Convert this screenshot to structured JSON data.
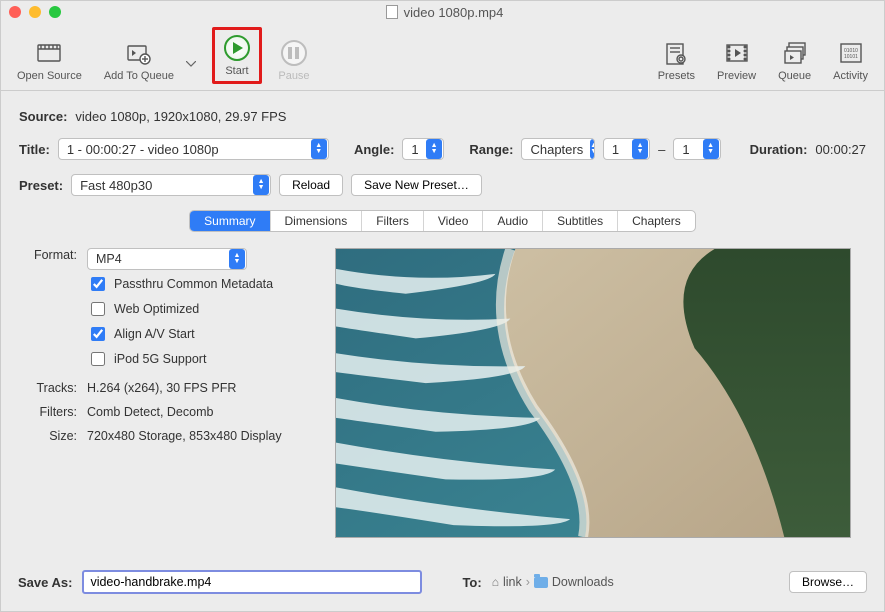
{
  "title": "video 1080p.mp4",
  "toolbar": {
    "open_source": "Open Source",
    "add_to_queue": "Add To Queue",
    "start": "Start",
    "pause": "Pause",
    "presets": "Presets",
    "preview": "Preview",
    "queue": "Queue",
    "activity": "Activity"
  },
  "source": {
    "label": "Source:",
    "value": "video 1080p, 1920x1080, 29.97 FPS"
  },
  "title_row": {
    "label": "Title:",
    "value": "1 - 00:00:27 - video 1080p",
    "angle_label": "Angle:",
    "angle_value": "1",
    "range_label": "Range:",
    "range_mode": "Chapters",
    "range_from": "1",
    "range_sep": "–",
    "range_to": "1",
    "duration_label": "Duration:",
    "duration_value": "00:00:27"
  },
  "preset_row": {
    "label": "Preset:",
    "value": "Fast 480p30",
    "reload": "Reload",
    "save_new": "Save New Preset…"
  },
  "tabs": [
    "Summary",
    "Dimensions",
    "Filters",
    "Video",
    "Audio",
    "Subtitles",
    "Chapters"
  ],
  "active_tab": "Summary",
  "summary": {
    "format_label": "Format:",
    "format_value": "MP4",
    "checkboxes": [
      {
        "label": "Passthru Common Metadata",
        "checked": true
      },
      {
        "label": "Web Optimized",
        "checked": false
      },
      {
        "label": "Align A/V Start",
        "checked": true
      },
      {
        "label": "iPod 5G Support",
        "checked": false
      }
    ],
    "tracks_label": "Tracks:",
    "tracks_value": "H.264 (x264), 30 FPS PFR",
    "filters_label": "Filters:",
    "filters_value": "Comb Detect, Decomb",
    "size_label": "Size:",
    "size_value": "720x480 Storage, 853x480 Display"
  },
  "footer": {
    "save_as_label": "Save As:",
    "save_as_value": "video-handbrake.mp4",
    "to_label": "To:",
    "path_root": "link",
    "path_folder": "Downloads",
    "browse": "Browse…"
  }
}
